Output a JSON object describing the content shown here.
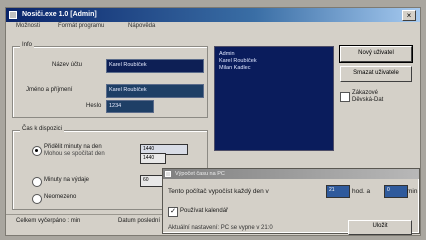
{
  "window": {
    "title": "Nosiči.exe 1.0 [Admin]",
    "close_glyph": "×"
  },
  "menu": [
    "Možnosti",
    "Formát programu",
    "Nápověda"
  ],
  "info_group": {
    "label": "Info",
    "name_label": "Název účtu",
    "name_value": "Karel Roubíček",
    "fullname_label": "Jméno a příjmení",
    "fullname_value": "Karel Roubíček",
    "password_label": "Heslo",
    "password_value": "1234"
  },
  "users_list": [
    "Admin",
    "Karel Roubíček",
    "Milan Kadlec"
  ],
  "buttons": {
    "new_user": "Nový uživatel",
    "delete_user": "Smazat uživatele"
  },
  "lock_checkbox": {
    "label_line1": "Zákazové",
    "label_line2": "Děvská-Dat",
    "checked": false
  },
  "time_group": {
    "label": "Čas k dispozici",
    "option1_line1": "Přidělit minuty na den",
    "option1_line2": "Mohou se spočítat den",
    "option1_value1": "1440",
    "option1_value2": "1440",
    "option2_label": "Minuty na výdaje",
    "option2_value": "60",
    "option3_label": "Neomezeno"
  },
  "status": {
    "left": "Celkem vyčerpáno : min",
    "right": "Datum poslední aktivity"
  },
  "dialog": {
    "title": "Výpočet času na PC",
    "calc_prefix": "Tento počítač vypočíst každý den v",
    "hour_value": "21",
    "hour_unit": "hod. a",
    "minute_value": "0",
    "minute_unit": "min",
    "use_checkbox_label": "Používat kalendář",
    "use_checked": true,
    "footer_text": "Aktuální nastavení: PC se vypne v 21:0",
    "save_button": "Uložit"
  },
  "colors": {
    "selection_blue": "#0d1f55",
    "titlebar_start": "#0a246a",
    "face": "#d4d0c8"
  }
}
